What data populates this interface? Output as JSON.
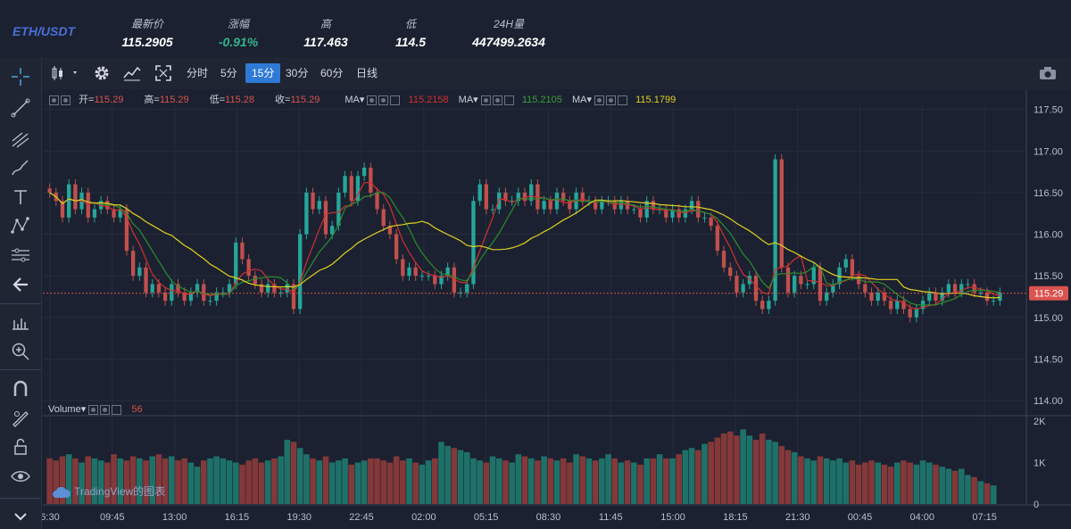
{
  "ticker": {
    "pair": "ETH/USDT",
    "stats": [
      {
        "label": "最新价",
        "value": "115.2905",
        "neg": false
      },
      {
        "label": "涨幅",
        "value": "-0.91%",
        "neg": true
      },
      {
        "label": "高",
        "value": "117.463",
        "neg": false
      },
      {
        "label": "低",
        "value": "114.5",
        "neg": false
      },
      {
        "label": "24H量",
        "value": "447499.2634",
        "neg": false
      }
    ]
  },
  "toolbar": {
    "intervals": [
      "分时",
      "5分",
      "15分",
      "30分",
      "60分",
      "日线"
    ],
    "active_interval": "15分"
  },
  "legend": {
    "open_label": "开=",
    "open": "115.29",
    "high_label": "高=",
    "high": "115.29",
    "low_label": "低=",
    "low": "115.28",
    "close_label": "收=",
    "close": "115.29",
    "ma_label": "MA",
    "ma_values": [
      "115.2158",
      "115.2105",
      "115.1799"
    ],
    "volume_label": "Volume",
    "volume_value": "56"
  },
  "watermark": "TradingView的图表",
  "colors": {
    "up": "#26a69a",
    "down": "#c0504d",
    "ma1": "#d32f2f",
    "ma2": "#2e8b2e",
    "ma3": "#e0d020",
    "accent": "#2f7ad6",
    "price_tag": "#d9534f"
  },
  "chart_data": {
    "type": "candlestick",
    "price_axis": [
      117.5,
      117.0,
      116.5,
      116.0,
      115.5,
      115.0,
      114.5,
      114.0
    ],
    "ylim": [
      113.85,
      117.55
    ],
    "volume_axis": [
      "2K",
      "1K",
      "0"
    ],
    "volume_ylim": [
      0,
      2000
    ],
    "time_axis": [
      "6:30",
      "09:45",
      "13:00",
      "16:15",
      "19:30",
      "22:45",
      "02:00",
      "05:15",
      "08:30",
      "11:45",
      "15:00",
      "18:15",
      "21:30",
      "00:45",
      "04:00",
      "07:15"
    ],
    "current_price": "115.29",
    "closes": [
      116.5,
      116.4,
      116.2,
      116.6,
      116.3,
      116.5,
      116.2,
      116.3,
      116.4,
      116.3,
      116.2,
      116.3,
      115.8,
      115.5,
      115.6,
      115.3,
      115.4,
      115.3,
      115.2,
      115.4,
      115.3,
      115.2,
      115.3,
      115.4,
      115.2,
      115.2,
      115.3,
      115.3,
      115.4,
      115.9,
      115.7,
      115.5,
      115.4,
      115.3,
      115.4,
      115.3,
      115.3,
      115.4,
      115.1,
      116.0,
      116.5,
      116.3,
      116.4,
      116.0,
      116.1,
      116.5,
      116.7,
      116.4,
      116.7,
      116.8,
      116.5,
      116.3,
      116.1,
      116.0,
      115.7,
      115.5,
      115.6,
      115.5,
      115.5,
      115.5,
      115.4,
      115.5,
      115.6,
      115.3,
      115.3,
      115.4,
      116.4,
      116.6,
      116.3,
      116.3,
      116.5,
      116.4,
      116.4,
      116.5,
      116.4,
      116.6,
      116.3,
      116.4,
      116.3,
      116.5,
      116.4,
      116.3,
      116.5,
      116.4,
      116.4,
      116.3,
      116.4,
      116.4,
      116.3,
      116.4,
      116.3,
      116.3,
      116.2,
      116.4,
      116.3,
      116.3,
      116.2,
      116.3,
      116.2,
      116.3,
      116.4,
      116.2,
      116.2,
      116.1,
      115.8,
      115.6,
      115.5,
      115.3,
      115.4,
      115.5,
      115.2,
      115.1,
      115.2,
      116.9,
      115.6,
      115.3,
      115.5,
      115.4,
      115.4,
      115.6,
      115.2,
      115.3,
      115.4,
      115.6,
      115.7,
      115.5,
      115.4,
      115.3,
      115.2,
      115.3,
      115.2,
      115.1,
      115.2,
      115.1,
      115.0,
      115.1,
      115.2,
      115.3,
      115.2,
      115.3,
      115.4,
      115.3,
      115.4,
      115.4,
      115.3,
      115.3,
      115.2,
      115.2,
      115.3
    ],
    "volumes": [
      1100,
      1050,
      1150,
      1200,
      1100,
      1000,
      1150,
      1100,
      1050,
      1000,
      1200,
      1100,
      1050,
      1150,
      1100,
      1050,
      1150,
      1200,
      1100,
      1150,
      1050,
      1100,
      1000,
      900,
      1050,
      1100,
      1150,
      1100,
      1050,
      1000,
      950,
      1050,
      1100,
      1000,
      1050,
      1100,
      1150,
      1550,
      1500,
      1350,
      1200,
      1100,
      1050,
      1150,
      1000,
      1050,
      1100,
      950,
      1000,
      1050,
      1100,
      1100,
      1050,
      1000,
      1150,
      1050,
      1100,
      1000,
      950,
      1050,
      1100,
      1500,
      1400,
      1350,
      1300,
      1250,
      1100,
      1050,
      1000,
      1150,
      1100,
      1050,
      1000,
      1200,
      1150,
      1100,
      1050,
      1150,
      1100,
      1050,
      1100,
      1000,
      1200,
      1150,
      1100,
      1050,
      1100,
      1200,
      1100,
      1000,
      1050,
      1000,
      950,
      1100,
      1100,
      1200,
      1100,
      1100,
      1200,
      1300,
      1350,
      1300,
      1450,
      1500,
      1600,
      1700,
      1750,
      1650,
      1800,
      1650,
      1550,
      1700,
      1550,
      1500,
      1400,
      1300,
      1250,
      1150,
      1100,
      1050,
      1150,
      1100,
      1050,
      1100,
      1000,
      1050,
      950,
      1000,
      1050,
      1000,
      950,
      900,
      1000,
      1050,
      1000,
      950,
      1050,
      1000,
      950,
      900,
      850,
      800,
      850,
      700,
      650,
      550,
      500,
      450
    ]
  }
}
